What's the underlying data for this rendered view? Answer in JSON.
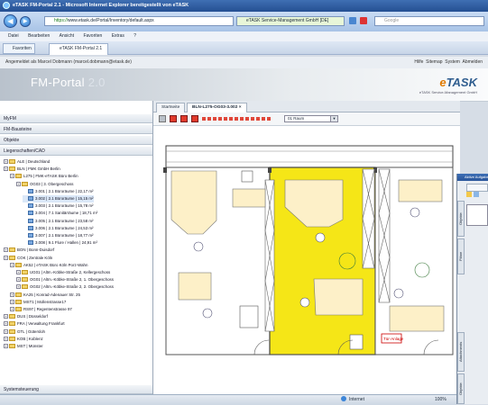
{
  "window": {
    "title": "eTASK FM-Portal 2.1 - Microsoft Internet Explorer bereitgestellt von eTASK"
  },
  "address": {
    "protocol": "https://",
    "url": "www.etask.de/Portal/Inventory/default.aspx",
    "ssl_label": "eTASK Service-Management GmbH [DE]",
    "search_placeholder": "Google"
  },
  "menu": [
    "Datei",
    "Bearbeiten",
    "Ansicht",
    "Favoriten",
    "Extras",
    "?"
  ],
  "favorites": {
    "label": "Favoriten",
    "tab_label": "eTASK FM-Portal 2.1"
  },
  "userbar": {
    "info": "Angemeldet als Marcel Dobmann (marcel.dobmann@etask.de)",
    "links": [
      "Hilfe",
      "Sitemap",
      "System",
      "Abmelden"
    ]
  },
  "header": {
    "portal_name": "FM-Portal",
    "portal_version": "2.0",
    "brand_e": "e",
    "brand_rest": "TASK",
    "brand_sub": "eTASK Service-Management GmbH"
  },
  "sidebar": {
    "panels": [
      "MyFM",
      "FM-Bausteine",
      "Objekte",
      "Liegenschaften/CAD"
    ],
    "bottom_panel": "Systemsteuerung",
    "tree": [
      {
        "text": "ALE | Deutschland",
        "level": 0,
        "icon": "folder"
      },
      {
        "text": "BLN | FMK GmbH Berlin",
        "level": 0,
        "icon": "folder"
      },
      {
        "text": "L275 | FMK-eTASK Büro Berlin",
        "level": 1,
        "icon": "folder"
      },
      {
        "text": "OG03 | 3. Obergeschoss",
        "level": 2,
        "icon": "folder"
      },
      {
        "text": "3.001 | 2.1 Büroräume | 22,17 m²",
        "level": 3,
        "icon": "room"
      },
      {
        "text": "3.002 | 2.1 Büroräume | 15,15 m²",
        "level": 3,
        "icon": "room",
        "selected": true
      },
      {
        "text": "3.003 | 2.1 Büroräume | 15,78 m²",
        "level": 3,
        "icon": "room"
      },
      {
        "text": "3.004 | 7.1 Sanitärräume | 18,71 m²",
        "level": 3,
        "icon": "room"
      },
      {
        "text": "3.005 | 2.1 Büroräume | 23,58 m²",
        "level": 3,
        "icon": "room"
      },
      {
        "text": "3.006 | 2.1 Büroräume | 24,53 m²",
        "level": 3,
        "icon": "room"
      },
      {
        "text": "3.007 | 2.1 Büroräume | 18,77 m²",
        "level": 3,
        "icon": "room"
      },
      {
        "text": "3.008 | 9.1 Flure / Hallen | 24,91 m²",
        "level": 3,
        "icon": "room"
      },
      {
        "text": "BON | Bonn-Duisdorf",
        "level": 0,
        "icon": "folder"
      },
      {
        "text": "COK | Zentrale Köln",
        "level": 0,
        "icon": "folder"
      },
      {
        "text": "AK52 | eTASK Büro Köln Porz-Wahn",
        "level": 1,
        "icon": "folder"
      },
      {
        "text": "UG01 | Altm.-Köbke-Straße 2, Kellergeschoss",
        "level": 2,
        "icon": "folder"
      },
      {
        "text": "OG01 | Altm.-Köbke-Straße 2, 1. Obergeschoss",
        "level": 2,
        "icon": "folder"
      },
      {
        "text": "OG02 | Altm.-Köbke-Straße 2, 2. Obergeschoss",
        "level": 2,
        "icon": "folder"
      },
      {
        "text": "KA25 | Konrad-Adenauer Str. 25",
        "level": 1,
        "icon": "folder"
      },
      {
        "text": "MST1 | Mollenstrasse17",
        "level": 1,
        "icon": "folder"
      },
      {
        "text": "RS97 | Regentenstrasse 97",
        "level": 1,
        "icon": "folder"
      },
      {
        "text": "DUS | Düsseldorf",
        "level": 0,
        "icon": "folder"
      },
      {
        "text": "FRA | Verwaltung Frankfurt",
        "level": 0,
        "icon": "folder"
      },
      {
        "text": "GTL | Gütersloh",
        "level": 0,
        "icon": "folder"
      },
      {
        "text": "KOB | Koblenz",
        "level": 0,
        "icon": "folder"
      },
      {
        "text": "MST | Münster",
        "level": 0,
        "icon": "folder"
      }
    ]
  },
  "main": {
    "tabs": [
      "Startseite",
      "BLN-L275-OG03-3.002"
    ],
    "floor_select": "01 Raum",
    "plan_label": "Tür-Anlage"
  },
  "float_window": {
    "title": "Aktive Aufgaben",
    "vtabs": [
      "Objekte",
      "Pläne",
      "Attachments",
      "Objekte"
    ]
  },
  "status": {
    "zone": "Internet",
    "zoom": "100%"
  },
  "colors": {
    "room_highlight": "#f5e617",
    "furniture": "#fdf0c8",
    "accent": "#2f5d8f",
    "brand_orange": "#e07a00"
  }
}
